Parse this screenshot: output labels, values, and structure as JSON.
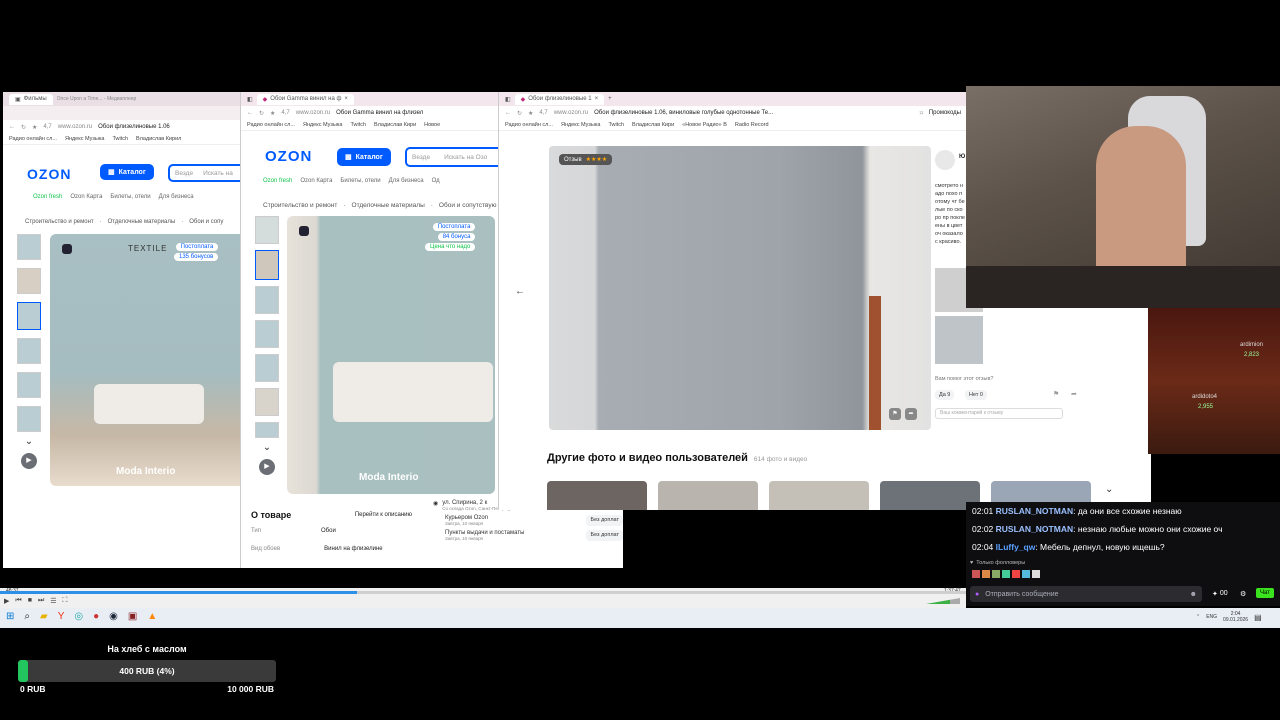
{
  "back_window": {
    "title": "Once Upon a Time... - Медиаплеер",
    "tab_label": "Фильмы",
    "address_rating": "4,7",
    "address_url": "www.ozon.ru",
    "address_title": "Обои флизелиновые 1.06",
    "bookmarks": [
      "Радио онлайн сл...",
      "Яндекс Музыка",
      "Twitch",
      "Владислав Кирил"
    ],
    "logo": "OZON",
    "catalog_label": "Каталог",
    "search_placeholder": "Везде",
    "search_hint": "Искать на",
    "nav": [
      "Ozon fresh",
      "Ozon Карта",
      "Билеты, отели",
      "Для бизнеса"
    ],
    "breadcrumb": [
      "Строительство и ремонт",
      "Отделочные материалы",
      "Обои и сопу"
    ],
    "image_caption": "TEXTILE",
    "badges": [
      "Постоплата",
      "135 бонусов"
    ],
    "watermark": "Moda Interio"
  },
  "mid_window": {
    "tab_label": "Обои Gamma винил на ф",
    "address_rating": "4,7",
    "address_url": "www.ozon.ru",
    "address_title": "Обои Gamma винил на флизел",
    "bookmarks": [
      "Радио онлайн сл...",
      "Яндекс Музыка",
      "Twitch",
      "Владислав Кири",
      "Новое"
    ],
    "logo": "OZON",
    "catalog_label": "Каталог",
    "search_placeholder": "Везде",
    "search_hint": "Искать на Озо",
    "nav": [
      "Ozon fresh",
      "Ozon Карта",
      "Билеты, отели",
      "Для бизнеса",
      "Од"
    ],
    "breadcrumb": [
      "Строительство и ремонт",
      "Отделочные материалы",
      "Обои и сопутствую"
    ],
    "badges": [
      "Постоплата",
      "84 бонуса",
      "Цена что надо"
    ],
    "watermark": "Moda Interio",
    "about_title": "О товаре",
    "about_link": "Перейти к описанию",
    "spec_type_label": "Тип",
    "spec_type_value": "Обои",
    "spec_kind_label": "Вид обоев",
    "spec_kind_value": "Винил на флизелине",
    "delivery_addr": "ул. Спирина, 2 к",
    "delivery_addr_sub": "Со склада Ozon, Санкт-Петербург",
    "delivery_courier": "Курьером Ozon",
    "delivery_courier_sub": "Завтра, 10 января",
    "delivery_courier_price": "Без доплат",
    "delivery_pickup": "Пункты выдачи и постаматы",
    "delivery_pickup_sub": "Завтра, 10 января",
    "delivery_pickup_price": "Без доплат"
  },
  "front_window": {
    "tab_label": "Обои флизелиновые 1",
    "address_rating": "4,7",
    "address_url": "www.ozon.ru",
    "address_title": "Обои флизелиновые 1.06, виниловые голубые однотонные Те...",
    "promo": "Промокоды",
    "bookmarks": [
      "Радио онлайн сл...",
      "Яндекс Музыка",
      "Twitch",
      "Владислав Кири",
      "«Новое Радио» В",
      "Radio Record"
    ],
    "review_badge": "Отзыв",
    "review_text": "смотрето надо похо потому чт белые по скоро пр поклеены в цветоч оказалос красиво.",
    "review_user_short": "Ю",
    "helpful_question": "Вам помог этот отзыв?",
    "yes_label": "Да 9",
    "no_label": "Нет 0",
    "comment_placeholder": "Ваш комментарий к отзыву",
    "other_title": "Другие фото и видео пользователей",
    "other_count": "614 фото и видео"
  },
  "player": {
    "time_left": "48:37",
    "time_right": "1:37:47",
    "progress": 0.37
  },
  "taskbar": {
    "lang": "ENG",
    "time": "2:04",
    "date": "09.01.2026"
  },
  "chat": {
    "messages": [
      {
        "time": "02:01",
        "name": "RUSLAN_NOTMAN",
        "text": ": да они все схожие незнаю"
      },
      {
        "time": "02:02",
        "name": "RUSLAN_NOTMAN",
        "text": ": незнаю любые можно они схожие оч"
      },
      {
        "time": "02:04",
        "name": "lLuffy_qw",
        "text": ": Мебель депнул, новую ищешь?"
      }
    ],
    "followers_only": "Только фолловеры",
    "input_placeholder": "Отправить сообщение",
    "send_label": "Чат",
    "points": "00"
  },
  "game_overlay": {
    "name1": "ardimion",
    "val1": "2,823",
    "name2": "ardidoto4",
    "val2": "2,955"
  },
  "donation": {
    "title": "На хлеб с маслом",
    "progress_text": "400 RUB (4%)",
    "progress": 0.04,
    "min": "0 RUB",
    "max": "10 000 RUB",
    "color": "#22c55e"
  }
}
